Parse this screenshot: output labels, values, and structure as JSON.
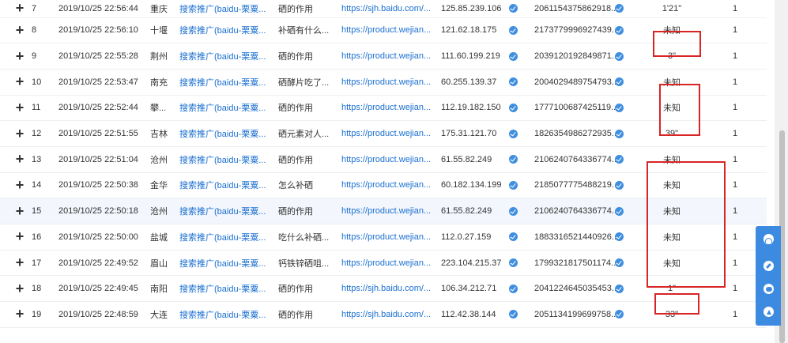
{
  "rows": [
    {
      "index": "7",
      "time": "2019/10/25 22:56:44",
      "city": "重庆",
      "source": "搜索推广(baidu-栗粟...",
      "keyword": "硒的作用",
      "url": "https://sjh.baidu.com/...",
      "ip": "125.85.239.106",
      "visitor_id": "2061154375862918...",
      "duration": "1'21\"",
      "count": "1"
    },
    {
      "index": "8",
      "time": "2019/10/25 22:56:10",
      "city": "十堰",
      "source": "搜索推广(baidu-栗粟...",
      "keyword": "补硒有什么...",
      "url": "https://product.wejian...",
      "ip": "121.62.18.175",
      "visitor_id": "2173779996927439...",
      "duration": "未知",
      "count": "1"
    },
    {
      "index": "9",
      "time": "2019/10/25 22:55:28",
      "city": "荆州",
      "source": "搜索推广(baidu-栗粟...",
      "keyword": "硒的作用",
      "url": "https://product.wejian...",
      "ip": "111.60.199.219",
      "visitor_id": "2039120192849871...",
      "duration": "3\"",
      "count": "1"
    },
    {
      "index": "10",
      "time": "2019/10/25 22:53:47",
      "city": "南充",
      "source": "搜索推广(baidu-栗粟...",
      "keyword": "硒酵片吃了...",
      "url": "https://product.wejian...",
      "ip": "60.255.139.37",
      "visitor_id": "2004029489754793...",
      "duration": "未知",
      "count": "1"
    },
    {
      "index": "11",
      "time": "2019/10/25 22:52:44",
      "city": "攀...",
      "source": "搜索推广(baidu-栗粟...",
      "keyword": "硒的作用",
      "url": "https://product.wejian...",
      "ip": "112.19.182.150",
      "visitor_id": "1777100687425119...",
      "duration": "未知",
      "count": "1"
    },
    {
      "index": "12",
      "time": "2019/10/25 22:51:55",
      "city": "吉林",
      "source": "搜索推广(baidu-栗粟...",
      "keyword": "硒元素对人...",
      "url": "https://product.wejian...",
      "ip": "175.31.121.70",
      "visitor_id": "1826354986272935...",
      "duration": "39\"",
      "count": "1"
    },
    {
      "index": "13",
      "time": "2019/10/25 22:51:04",
      "city": "沧州",
      "source": "搜索推广(baidu-栗粟...",
      "keyword": "硒的作用",
      "url": "https://product.wejian...",
      "ip": "61.55.82.249",
      "visitor_id": "2106240764336774...",
      "duration": "未知",
      "count": "1"
    },
    {
      "index": "14",
      "time": "2019/10/25 22:50:38",
      "city": "金华",
      "source": "搜索推广(baidu-栗粟...",
      "keyword": "怎么补硒",
      "url": "https://product.wejian...",
      "ip": "60.182.134.199",
      "visitor_id": "2185077775488219...",
      "duration": "未知",
      "count": "1"
    },
    {
      "index": "15",
      "time": "2019/10/25 22:50:18",
      "city": "沧州",
      "source": "搜索推广(baidu-栗粟...",
      "keyword": "硒的作用",
      "url": "https://product.wejian...",
      "ip": "61.55.82.249",
      "visitor_id": "2106240764336774...",
      "duration": "未知",
      "count": "1"
    },
    {
      "index": "16",
      "time": "2019/10/25 22:50:00",
      "city": "盐城",
      "source": "搜索推广(baidu-栗粟...",
      "keyword": "吃什么补硒...",
      "url": "https://product.wejian...",
      "ip": "112.0.27.159",
      "visitor_id": "1883316521440926...",
      "duration": "未知",
      "count": "1"
    },
    {
      "index": "17",
      "time": "2019/10/25 22:49:52",
      "city": "眉山",
      "source": "搜索推广(baidu-栗粟...",
      "keyword": "钙铁锌硒咀...",
      "url": "https://product.wejian...",
      "ip": "223.104.215.37",
      "visitor_id": "1799321817501174...",
      "duration": "未知",
      "count": "1"
    },
    {
      "index": "18",
      "time": "2019/10/25 22:49:45",
      "city": "南阳",
      "source": "搜索推广(baidu-栗粟...",
      "keyword": "硒的作用",
      "url": "https://sjh.baidu.com/...",
      "ip": "106.34.212.71",
      "visitor_id": "2041224645035453...",
      "duration": "1\"",
      "count": "1"
    },
    {
      "index": "19",
      "time": "2019/10/25 22:48:59",
      "city": "大连",
      "source": "搜索推广(baidu-栗粟...",
      "keyword": "硒的作用",
      "url": "https://sjh.baidu.com/...",
      "ip": "112.42.38.144",
      "visitor_id": "2051134199699758...",
      "duration": "33\"",
      "count": "1"
    }
  ],
  "expand_symbol": "+",
  "icons": {
    "row_icon": "trend-badge-icon",
    "floating_toolbar": [
      "headset-icon",
      "compass-icon",
      "chat-icon",
      "arrow-up-icon"
    ]
  },
  "colors": {
    "link": "#1a6fd0",
    "highlight_box": "#d92424",
    "floating_toolbar": "#3d8be1",
    "badge": "#3f8fe0"
  }
}
